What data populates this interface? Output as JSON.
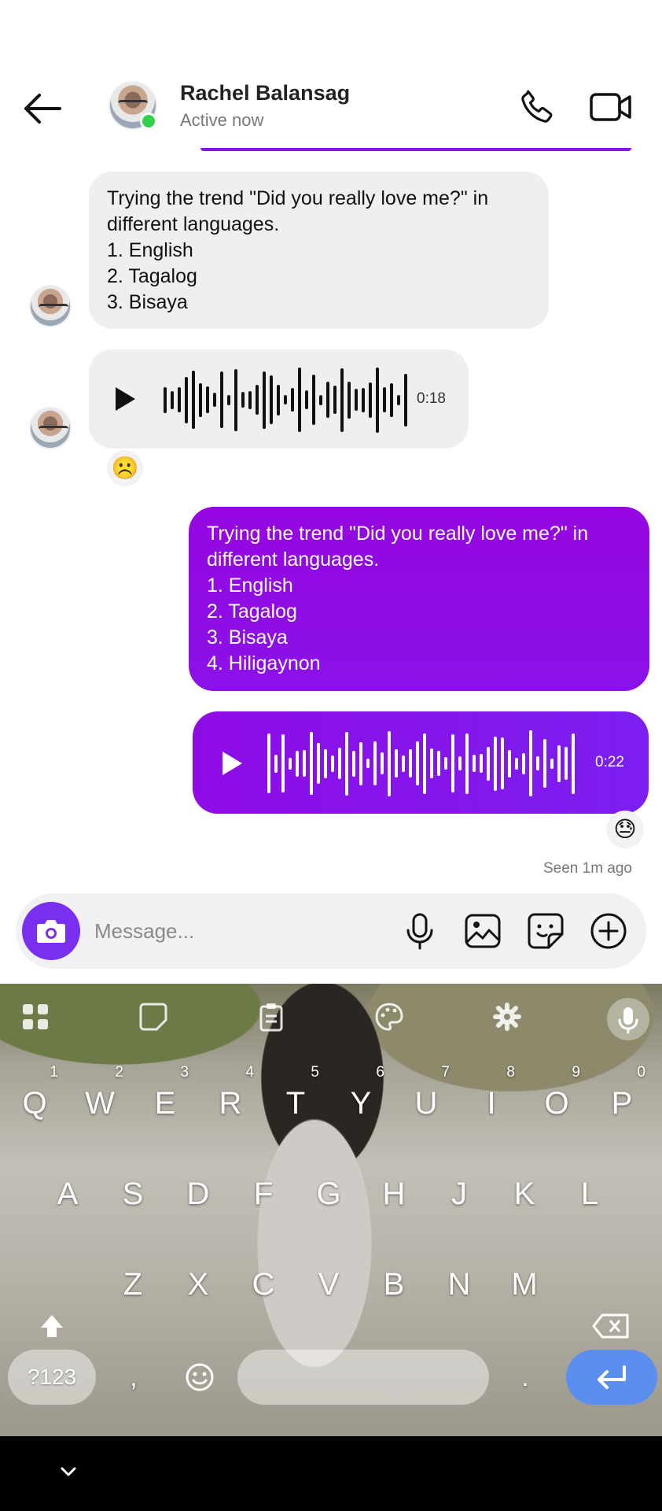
{
  "header": {
    "contact_name": "Rachel Balansag",
    "status": "Active now"
  },
  "messages": [
    {
      "direction": "incoming",
      "lines": [
        "Trying the trend \"Did you really love me?\" in",
        "different languages.",
        "1. English",
        "2. Tagalog",
        "3. Bisaya"
      ]
    },
    {
      "direction": "incoming",
      "type": "voice",
      "duration": "0:18",
      "reaction": "☹️"
    },
    {
      "direction": "outgoing",
      "lines": [
        "Trying the trend \"Did you really love me?\" in",
        "different languages.",
        "1. English",
        "2. Tagalog",
        "3. Bisaya",
        "4. Hiligaynon"
      ]
    },
    {
      "direction": "outgoing",
      "type": "voice",
      "duration": "0:22",
      "reaction": "😓"
    }
  ],
  "seen_status": "Seen 1m ago",
  "composer": {
    "placeholder": "Message..."
  },
  "keyboard": {
    "row1": [
      {
        "key": "Q",
        "num": "1"
      },
      {
        "key": "W",
        "num": "2"
      },
      {
        "key": "E",
        "num": "3"
      },
      {
        "key": "R",
        "num": "4"
      },
      {
        "key": "T",
        "num": "5"
      },
      {
        "key": "Y",
        "num": "6"
      },
      {
        "key": "U",
        "num": "7"
      },
      {
        "key": "I",
        "num": "8"
      },
      {
        "key": "O",
        "num": "9"
      },
      {
        "key": "P",
        "num": "0"
      }
    ],
    "row2": [
      "A",
      "S",
      "D",
      "F",
      "G",
      "H",
      "J",
      "K",
      "L"
    ],
    "row3": [
      "Z",
      "X",
      "C",
      "V",
      "B",
      "N",
      "M"
    ],
    "symbols_label": "?123",
    "comma": ",",
    "period": "."
  },
  "colors": {
    "accent": "#8a14e0",
    "online": "#31d14a",
    "enter_key": "#5a8ff0"
  }
}
